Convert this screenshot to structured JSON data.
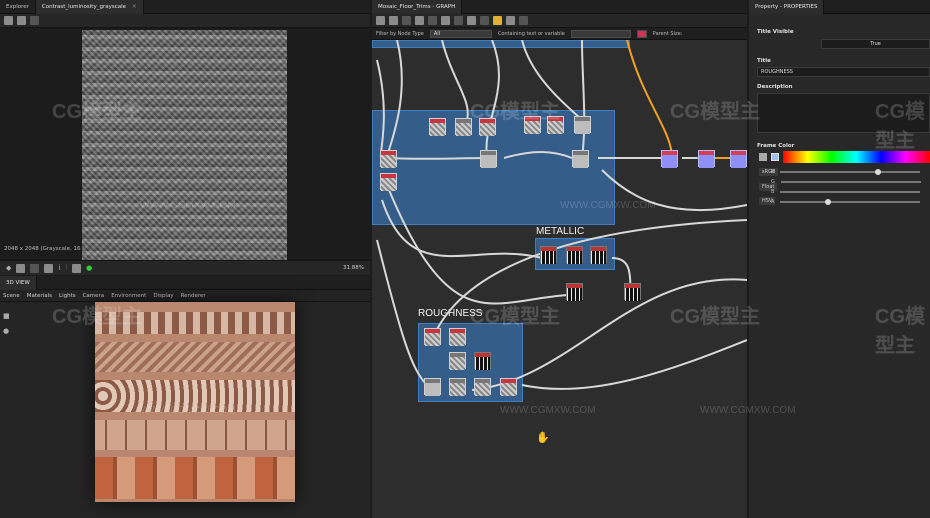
{
  "left_top": {
    "tabs": [
      {
        "label": "Explorer"
      },
      {
        "label": "Contrast_luminosity_grayscale",
        "active": true
      }
    ],
    "status": "2048 x 2048 (Grayscale, 16",
    "zoom": "31.88%"
  },
  "left_bottom": {
    "title": "3D VIEW",
    "menu": [
      "Scene",
      "Materials",
      "Lights",
      "Camera",
      "Environment",
      "Display",
      "Renderer"
    ]
  },
  "graph": {
    "title": "Mosaic_Floor_Trims - GRAPH",
    "filter_label": "Filter by Node Type",
    "filter_value": "All",
    "search_placeholder": "Containing text or variable",
    "parent_size_label": "Parent Size:",
    "frames": [
      "METALLIC",
      "ROUGHNESS"
    ]
  },
  "properties": {
    "title": "Property - PROPERTIES",
    "title_visible_label": "Title Visible",
    "title_visible_value": "True",
    "title_label": "Title",
    "title_value": "ROUGHNESS",
    "description_label": "Description",
    "frame_color_label": "Frame Color",
    "color_modes": [
      "sRGB",
      "Float",
      "HSV"
    ],
    "channels": [
      "R",
      "G",
      "B",
      "A"
    ]
  },
  "watermark": {
    "brand": "CG模型主",
    "url": "WWW.CGMXW.COM"
  },
  "colors": {
    "frame_blue": "#376eaa",
    "wire": "#d8d8d8",
    "orange_wire": "#f0a020"
  }
}
